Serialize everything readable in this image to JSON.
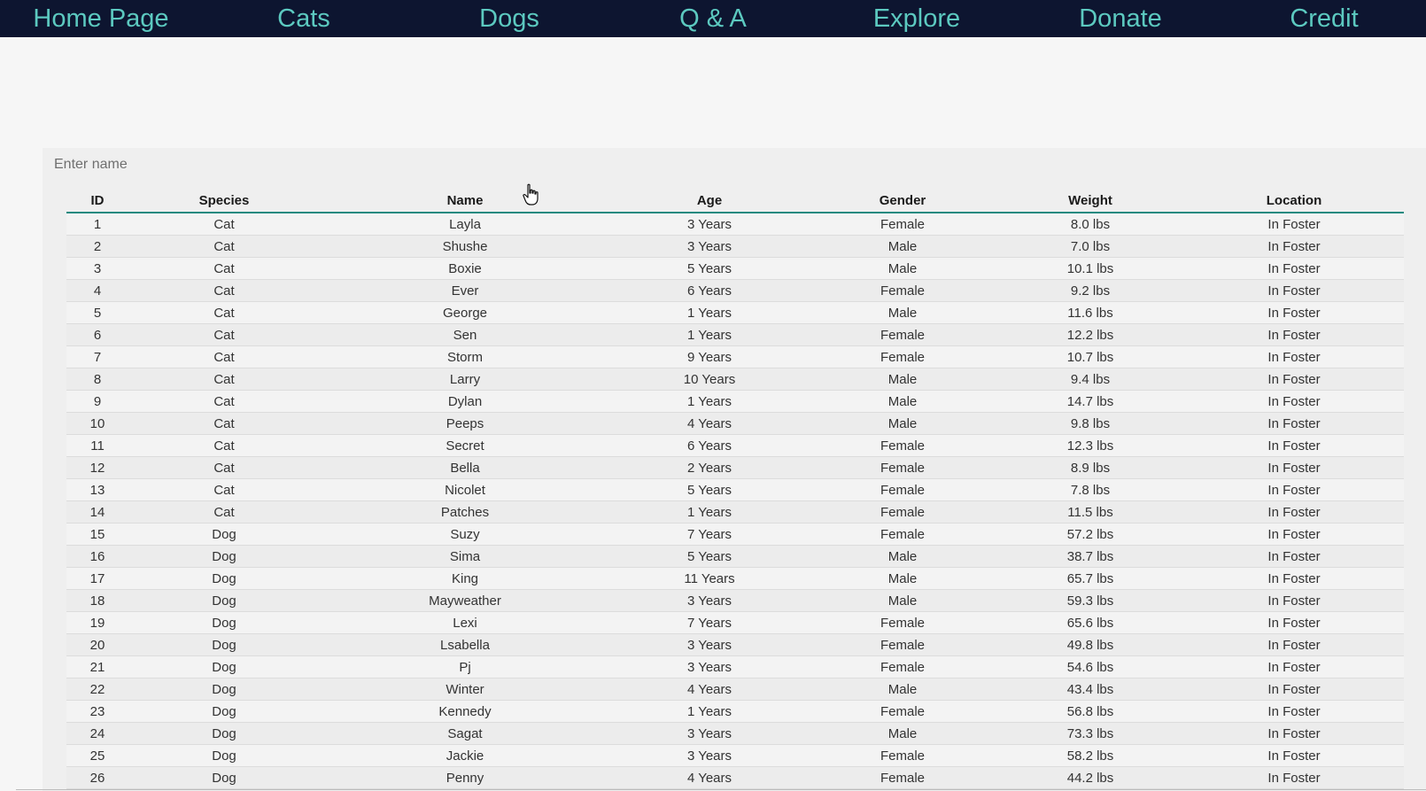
{
  "nav": {
    "items": [
      "Home Page",
      "Cats",
      "Dogs",
      "Q & A",
      "Explore",
      "Donate",
      "Credit"
    ]
  },
  "search": {
    "placeholder": "Enter name",
    "value": ""
  },
  "table": {
    "columns": [
      "ID",
      "Species",
      "Name",
      "Age",
      "Gender",
      "Weight",
      "Location"
    ],
    "rows": [
      [
        "1",
        "Cat",
        "Layla",
        "3 Years",
        "Female",
        "8.0 lbs",
        "In Foster"
      ],
      [
        "2",
        "Cat",
        "Shushe",
        "3 Years",
        "Male",
        "7.0 lbs",
        "In Foster"
      ],
      [
        "3",
        "Cat",
        "Boxie",
        "5 Years",
        "Male",
        "10.1 lbs",
        "In Foster"
      ],
      [
        "4",
        "Cat",
        "Ever",
        "6 Years",
        "Female",
        "9.2 lbs",
        "In Foster"
      ],
      [
        "5",
        "Cat",
        "George",
        "1 Years",
        "Male",
        "11.6 lbs",
        "In Foster"
      ],
      [
        "6",
        "Cat",
        "Sen",
        "1 Years",
        "Female",
        "12.2 lbs",
        "In Foster"
      ],
      [
        "7",
        "Cat",
        "Storm",
        "9 Years",
        "Female",
        "10.7 lbs",
        "In Foster"
      ],
      [
        "8",
        "Cat",
        "Larry",
        "10 Years",
        "Male",
        "9.4 lbs",
        "In Foster"
      ],
      [
        "9",
        "Cat",
        "Dylan",
        "1 Years",
        "Male",
        "14.7 lbs",
        "In Foster"
      ],
      [
        "10",
        "Cat",
        "Peeps",
        "4 Years",
        "Male",
        "9.8 lbs",
        "In Foster"
      ],
      [
        "11",
        "Cat",
        "Secret",
        "6 Years",
        "Female",
        "12.3 lbs",
        "In Foster"
      ],
      [
        "12",
        "Cat",
        "Bella",
        "2 Years",
        "Female",
        "8.9 lbs",
        "In Foster"
      ],
      [
        "13",
        "Cat",
        "Nicolet",
        "5 Years",
        "Female",
        "7.8 lbs",
        "In Foster"
      ],
      [
        "14",
        "Cat",
        "Patches",
        "1 Years",
        "Female",
        "11.5 lbs",
        "In Foster"
      ],
      [
        "15",
        "Dog",
        "Suzy",
        "7 Years",
        "Female",
        "57.2 lbs",
        "In Foster"
      ],
      [
        "16",
        "Dog",
        "Sima",
        "5 Years",
        "Male",
        "38.7 lbs",
        "In Foster"
      ],
      [
        "17",
        "Dog",
        "King",
        "11 Years",
        "Male",
        "65.7 lbs",
        "In Foster"
      ],
      [
        "18",
        "Dog",
        "Mayweather",
        "3 Years",
        "Male",
        "59.3 lbs",
        "In Foster"
      ],
      [
        "19",
        "Dog",
        "Lexi",
        "7 Years",
        "Female",
        "65.6 lbs",
        "In Foster"
      ],
      [
        "20",
        "Dog",
        "Lsabella",
        "3 Years",
        "Female",
        "49.8 lbs",
        "In Foster"
      ],
      [
        "21",
        "Dog",
        "Pj",
        "3 Years",
        "Female",
        "54.6 lbs",
        "In Foster"
      ],
      [
        "22",
        "Dog",
        "Winter",
        "4 Years",
        "Male",
        "43.4 lbs",
        "In Foster"
      ],
      [
        "23",
        "Dog",
        "Kennedy",
        "1 Years",
        "Female",
        "56.8 lbs",
        "In Foster"
      ],
      [
        "24",
        "Dog",
        "Sagat",
        "3 Years",
        "Male",
        "73.3 lbs",
        "In Foster"
      ],
      [
        "25",
        "Dog",
        "Jackie",
        "3 Years",
        "Female",
        "58.2 lbs",
        "In Foster"
      ],
      [
        "26",
        "Dog",
        "Penny",
        "4 Years",
        "Female",
        "44.2 lbs",
        "In Foster"
      ]
    ]
  },
  "cursor": {
    "icon": "hand-pointer-icon"
  }
}
